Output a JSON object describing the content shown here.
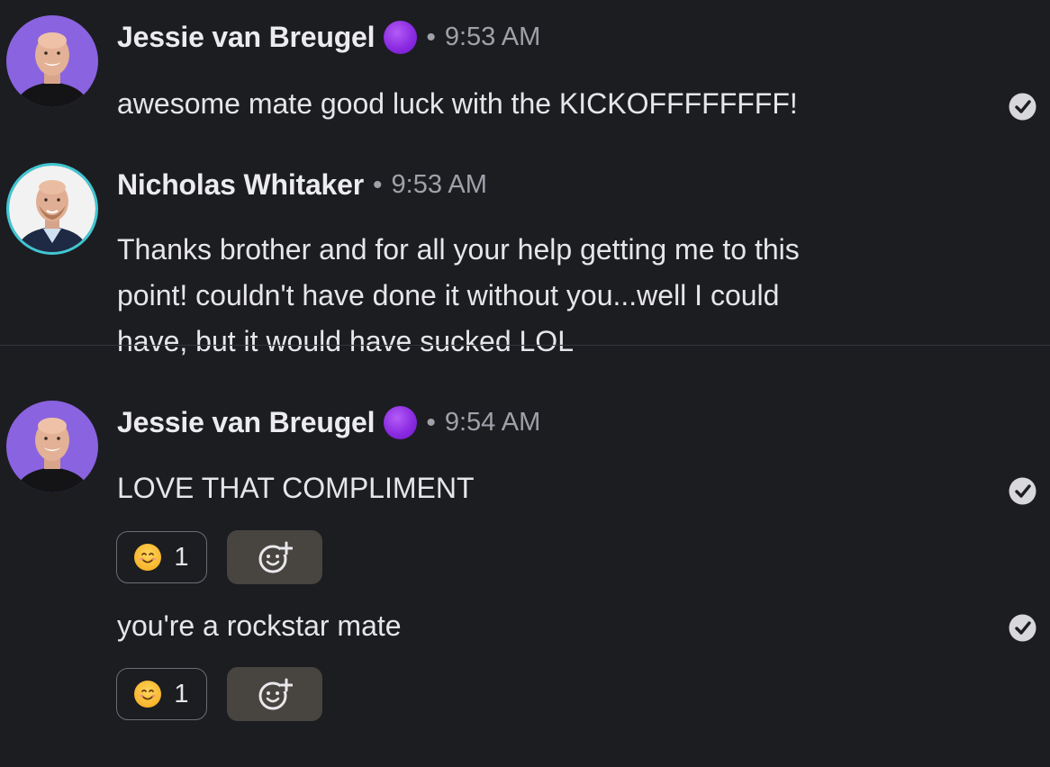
{
  "messages": [
    {
      "author": "Jessie van Breugel",
      "separator": "•",
      "time": "9:53 AM",
      "has_status_dot": true,
      "avatar_icon": "avatar-jessie",
      "lines": [
        "awesome mate good luck with the KICKOFFFFFFFF!"
      ],
      "read_receipt": "check-circle-icon"
    },
    {
      "author": "Nicholas Whitaker",
      "separator": "•",
      "time": "9:53 AM",
      "has_status_dot": false,
      "avatar_icon": "avatar-nicholas",
      "lines": [
        "Thanks brother and for all your help getting me to this",
        "point! couldn't have done it without you...well I could",
        "have, but it would have sucked LOL"
      ]
    },
    {
      "author": "Jessie van Breugel",
      "separator": "•",
      "time": "9:54 AM",
      "has_status_dot": true,
      "avatar_icon": "avatar-jessie",
      "lines": [
        "LOVE THAT COMPLIMENT"
      ],
      "read_receipt": "check-circle-icon",
      "reaction": {
        "emoji": "smiling-face-icon",
        "count": "1"
      }
    },
    {
      "continuation": true,
      "lines": [
        "you're a rockstar mate"
      ],
      "read_receipt": "check-circle-icon",
      "reaction": {
        "emoji": "smiling-face-icon",
        "count": "1"
      }
    }
  ],
  "colors": {
    "background": "#1c1d21",
    "status_dot": "#8b2be2",
    "avatar_ring": "#3fc7d2",
    "jessie_avatar_bg": "#8a63e0",
    "add_reaction_bg": "#48443f"
  }
}
